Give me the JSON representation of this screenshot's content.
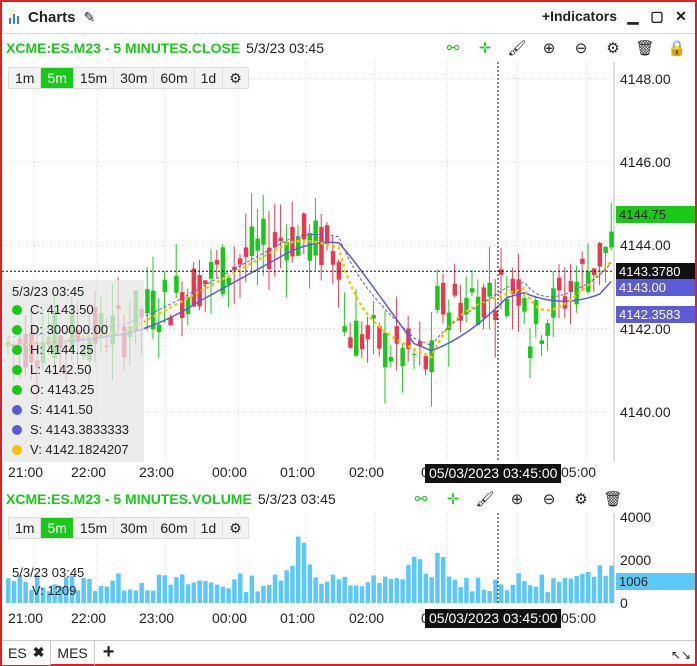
{
  "titlebar": {
    "title": "Charts",
    "indicators": "+Indicators"
  },
  "main": {
    "symbol": "XCME:ES.M23 - 5 MINUTES.CLOSE",
    "timestamp": "5/3/23 03:45",
    "timeframes": [
      "1m",
      "5m",
      "15m",
      "30m",
      "60m",
      "1d"
    ],
    "active_tf": "5m",
    "price_ticks": [
      {
        "label": "4148.00",
        "value": 4148.0
      },
      {
        "label": "4146.00",
        "value": 4146.0
      },
      {
        "label": "4144.00",
        "value": 4144.0
      },
      {
        "label": "4142.00",
        "value": 4142.0
      },
      {
        "label": "4140.00",
        "value": 4140.0
      }
    ],
    "tags": [
      {
        "label": "4144.75",
        "value": 4144.75,
        "bg": "#19c919",
        "fg": "#222"
      },
      {
        "label": "4143.3780",
        "value": 4143.378,
        "bg": "#111",
        "fg": "#fff"
      },
      {
        "label": "4143.00",
        "value": 4143.0,
        "bg": "#5b5bd6",
        "fg": "#fff"
      },
      {
        "label": "4142.3583",
        "value": 4142.3583,
        "bg": "#5b5bd6",
        "fg": "#fff"
      }
    ],
    "info": {
      "date": "5/3/23 03:45",
      "rows": [
        {
          "text": "C: 4143.50",
          "color": "#19c919"
        },
        {
          "text": "D: 300000.00",
          "color": "#19c919"
        },
        {
          "text": "H: 4144.25",
          "color": "#19c919"
        },
        {
          "text": "L: 4142.50",
          "color": "#19c919"
        },
        {
          "text": "O: 4143.25",
          "color": "#19c919"
        },
        {
          "text": "S: 4141.50",
          "color": "#5b5bd6"
        },
        {
          "text": "S: 4143.3833333",
          "color": "#5b5bd6"
        },
        {
          "text": "V: 4142.1824207",
          "color": "#f5c400"
        }
      ]
    },
    "time_labels": [
      "21:00",
      "22:00",
      "23:00",
      "00:00",
      "01:00",
      "02:00",
      "03:00",
      "04:00",
      "05:00"
    ],
    "crosshair_time": "05/03/2023 03:45:00"
  },
  "volume": {
    "symbol": "XCME:ES.M23 - 5 MINUTES.VOLUME",
    "timestamp": "5/3/23 03:45",
    "ticks": [
      {
        "label": "4000",
        "value": 4000
      },
      {
        "label": "2000",
        "value": 2000
      },
      {
        "label": "0",
        "value": 0
      }
    ],
    "tag": {
      "label": "1006",
      "value": 1006
    },
    "info": {
      "date": "5/3/23 03:45",
      "v": "V: 1209"
    },
    "crosshair_time": "05/03/2023 03:45:00"
  },
  "tabs": [
    {
      "label": "ES",
      "active": true
    },
    {
      "label": "MES",
      "active": false
    }
  ],
  "colors": {
    "up": "#19c919",
    "down": "#e8394f",
    "sma": "#5b5bd6",
    "ema": "#f5c400",
    "vol": "#5bc8f5"
  },
  "chart_data": {
    "type": "candlestick",
    "interval": "5m",
    "y_range": [
      4138.8,
      4148.4
    ],
    "x_range": [
      "20:45",
      "05:40"
    ],
    "candles": [],
    "volume": []
  }
}
